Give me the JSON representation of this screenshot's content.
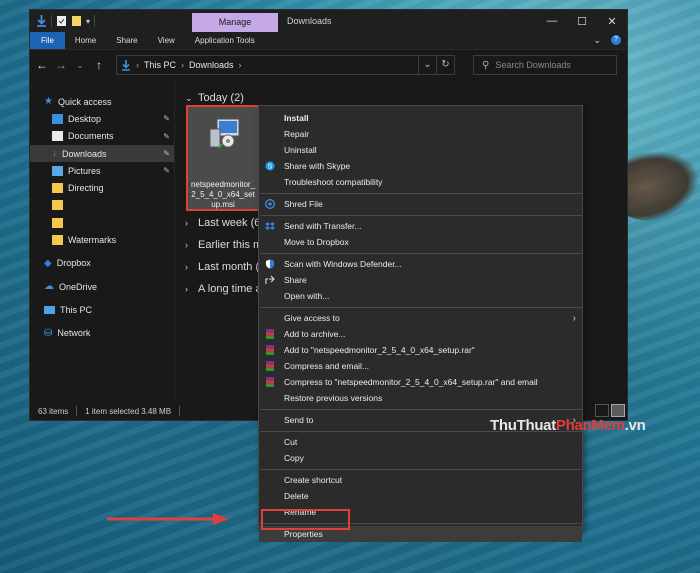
{
  "window": {
    "context_tab": "Manage",
    "title": "Downloads",
    "controls": [
      "—",
      "☐",
      "✕"
    ]
  },
  "ribbon": {
    "tabs": [
      "File",
      "Home",
      "Share",
      "View",
      "Application Tools"
    ]
  },
  "address": {
    "crumbs": [
      "This PC",
      "Downloads"
    ],
    "search_placeholder": "Search Downloads"
  },
  "sidebar": {
    "items": [
      {
        "label": "Quick access",
        "icon": "star-icon"
      },
      {
        "label": "Desktop",
        "icon": "desktop-folder-icon"
      },
      {
        "label": "Documents",
        "icon": "documents-folder-icon"
      },
      {
        "label": "Downloads",
        "icon": "downloads-folder-icon"
      },
      {
        "label": "Pictures",
        "icon": "pictures-folder-icon"
      },
      {
        "label": "Directing",
        "icon": "folder-icon"
      },
      {
        "label": "",
        "icon": "folder-icon"
      },
      {
        "label": "",
        "icon": "folder-icon"
      },
      {
        "label": "Watermarks",
        "icon": "folder-icon"
      },
      {
        "label": "Dropbox",
        "icon": "dropbox-icon"
      },
      {
        "label": "OneDrive",
        "icon": "onedrive-icon"
      },
      {
        "label": "This PC",
        "icon": "computer-icon"
      },
      {
        "label": "Network",
        "icon": "network-icon"
      }
    ]
  },
  "content": {
    "groups": [
      "Today (2)",
      "Last week (6",
      "Earlier this mo",
      "Last month (29",
      "A long time ag"
    ],
    "file_name": "netspeedmonitor_2_5_4_0_x64_setup.msi"
  },
  "status": {
    "count": "63 items",
    "selection": "1 item selected  3.48 MB"
  },
  "context_menu": {
    "items": [
      "Install",
      "Repair",
      "Uninstall",
      "Share with Skype",
      "Troubleshoot compatibility",
      "Shred File",
      "Send with Transfer...",
      "Move to Dropbox",
      "Scan with Windows Defender...",
      "Share",
      "Open with...",
      "Give access to",
      "Add to archive...",
      "Add to \"netspeedmonitor_2_5_4_0_x64_setup.rar\"",
      "Compress and email...",
      "Compress to \"netspeedmonitor_2_5_4_0_x64_setup.rar\" and email",
      "Restore previous versions",
      "Send to",
      "Cut",
      "Copy",
      "Create shortcut",
      "Delete",
      "Rename",
      "Properties"
    ]
  },
  "watermark": {
    "part1": "ThuThuat",
    "part2": "PhanMem",
    "part3": ".vn"
  },
  "colors": {
    "highlight_red": "#e0403c",
    "file_tab_blue": "#1a63b5",
    "manage_tab_purple": "#c5a9e7"
  }
}
